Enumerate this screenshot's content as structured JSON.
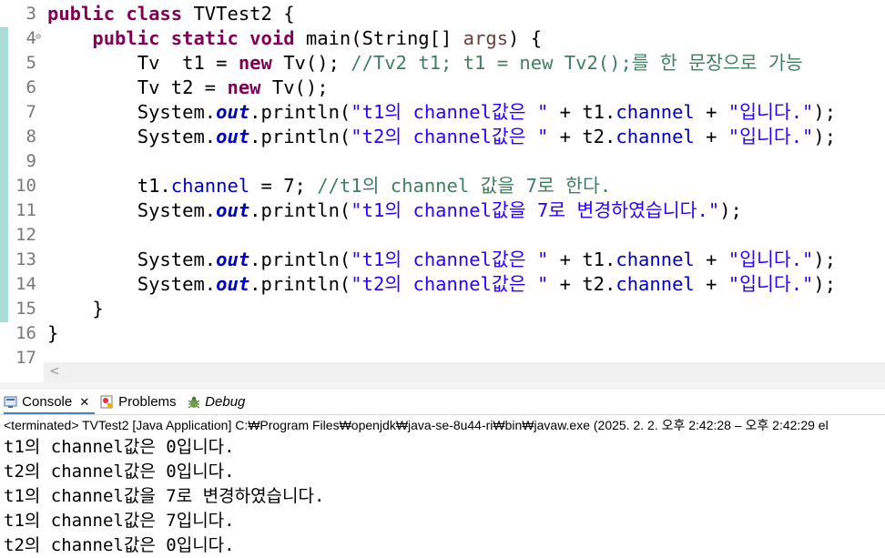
{
  "editor": {
    "lines": [
      {
        "num": "3",
        "tokens": [
          {
            "t": "public class ",
            "c": "kw"
          },
          {
            "t": "TVTest2 {",
            "c": ""
          }
        ]
      },
      {
        "num": "4",
        "fold": "⊖",
        "tokens": [
          {
            "t": "    ",
            "c": ""
          },
          {
            "t": "public static void ",
            "c": "kw"
          },
          {
            "t": "main(String[] ",
            "c": ""
          },
          {
            "t": "args",
            "c": "arg"
          },
          {
            "t": ") {",
            "c": ""
          }
        ]
      },
      {
        "num": "5",
        "tokens": [
          {
            "t": "        Tv  t1 = ",
            "c": ""
          },
          {
            "t": "new ",
            "c": "kw"
          },
          {
            "t": "Tv(); ",
            "c": ""
          },
          {
            "t": "//Tv2 t1; t1 = new Tv2();를 한 문장으로 가능",
            "c": "cm"
          }
        ]
      },
      {
        "num": "6",
        "tokens": [
          {
            "t": "        Tv t2 = ",
            "c": ""
          },
          {
            "t": "new ",
            "c": "kw"
          },
          {
            "t": "Tv();",
            "c": ""
          }
        ]
      },
      {
        "num": "7",
        "tokens": [
          {
            "t": "        System.",
            "c": ""
          },
          {
            "t": "out",
            "c": "sfld"
          },
          {
            "t": ".println(",
            "c": ""
          },
          {
            "t": "\"t1의 channel값은 \"",
            "c": "str"
          },
          {
            "t": " + t1.",
            "c": ""
          },
          {
            "t": "channel",
            "c": "fld"
          },
          {
            "t": " + ",
            "c": ""
          },
          {
            "t": "\"입니다.\"",
            "c": "str"
          },
          {
            "t": ");",
            "c": ""
          }
        ]
      },
      {
        "num": "8",
        "tokens": [
          {
            "t": "        System.",
            "c": ""
          },
          {
            "t": "out",
            "c": "sfld"
          },
          {
            "t": ".println(",
            "c": ""
          },
          {
            "t": "\"t2의 channel값은 \"",
            "c": "str"
          },
          {
            "t": " + t2.",
            "c": ""
          },
          {
            "t": "channel",
            "c": "fld"
          },
          {
            "t": " + ",
            "c": ""
          },
          {
            "t": "\"입니다.\"",
            "c": "str"
          },
          {
            "t": ");",
            "c": ""
          }
        ]
      },
      {
        "num": "9",
        "tokens": []
      },
      {
        "num": "10",
        "tokens": [
          {
            "t": "        t1.",
            "c": ""
          },
          {
            "t": "channel",
            "c": "fld"
          },
          {
            "t": " = 7; ",
            "c": ""
          },
          {
            "t": "//t1의 channel 값을 7로 한다.",
            "c": "cm"
          }
        ]
      },
      {
        "num": "11",
        "tokens": [
          {
            "t": "        System.",
            "c": ""
          },
          {
            "t": "out",
            "c": "sfld"
          },
          {
            "t": ".println(",
            "c": ""
          },
          {
            "t": "\"t1의 channel값을 7로 변경하였습니다.\"",
            "c": "str"
          },
          {
            "t": ");",
            "c": ""
          }
        ]
      },
      {
        "num": "12",
        "tokens": []
      },
      {
        "num": "13",
        "tokens": [
          {
            "t": "        System.",
            "c": ""
          },
          {
            "t": "out",
            "c": "sfld"
          },
          {
            "t": ".println(",
            "c": ""
          },
          {
            "t": "\"t1의 channel값은 \"",
            "c": "str"
          },
          {
            "t": " + t1.",
            "c": ""
          },
          {
            "t": "channel",
            "c": "fld"
          },
          {
            "t": " + ",
            "c": ""
          },
          {
            "t": "\"입니다.\"",
            "c": "str"
          },
          {
            "t": ");",
            "c": ""
          }
        ]
      },
      {
        "num": "14",
        "tokens": [
          {
            "t": "        System.",
            "c": ""
          },
          {
            "t": "out",
            "c": "sfld"
          },
          {
            "t": ".println(",
            "c": ""
          },
          {
            "t": "\"t2의 channel값은 \"",
            "c": "str"
          },
          {
            "t": " + t2.",
            "c": ""
          },
          {
            "t": "channel",
            "c": "fld"
          },
          {
            "t": " + ",
            "c": ""
          },
          {
            "t": "\"입니다.\"",
            "c": "str"
          },
          {
            "t": ");",
            "c": ""
          }
        ]
      },
      {
        "num": "15",
        "tokens": [
          {
            "t": "    }",
            "c": ""
          }
        ]
      },
      {
        "num": "16",
        "tokens": [
          {
            "t": "}",
            "c": ""
          }
        ]
      },
      {
        "num": "17",
        "tokens": []
      }
    ]
  },
  "tabs": {
    "console_label": "Console",
    "console_close": "✕",
    "problems_label": "Problems",
    "debug_label": "Debug"
  },
  "console": {
    "status": "<terminated> TVTest2 [Java Application] C:₩Program Files₩openjdk₩java-se-8u44-ri₩bin₩javaw.exe  (2025. 2. 2. 오후 2:42:28 – 오후 2:42:29 el",
    "output": [
      "t1의 channel값은 0입니다.",
      "t2의 channel값은 0입니다.",
      "t1의 channel값을 7로 변경하였습니다.",
      "t1의 channel값은 7입니다.",
      "t2의 channel값은 0입니다."
    ]
  },
  "colors": {
    "keyword": "#7f0055",
    "field": "#0000c0",
    "string": "#2a00ff",
    "comment": "#3f7f5f",
    "change_bar": "#a8dcd4"
  },
  "icons": {
    "console": "console-icon",
    "problems": "problems-icon",
    "debug": "debug-bug-icon",
    "scroll_left": "scroll-left-arrow-icon"
  }
}
